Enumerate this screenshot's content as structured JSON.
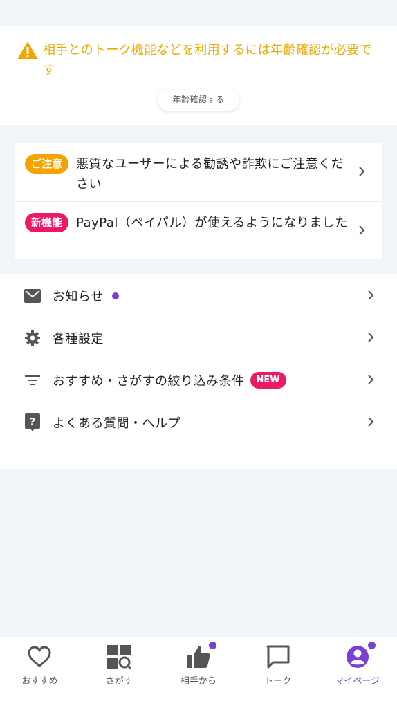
{
  "age_verification": {
    "message": "相手とのトーク機能などを利用するには年齢確認が必要です",
    "button_label": "年齢確認する",
    "accent_color": "#f0a800"
  },
  "notices": [
    {
      "badge": "ご注意",
      "badge_color": "#f5a300",
      "text": "悪質なユーザーによる勧誘や詐欺にご注意ください"
    },
    {
      "badge": "新機能",
      "badge_color": "#ec1a64",
      "text": "PayPal（ペイパル）が使えるようになりました"
    }
  ],
  "menu": [
    {
      "label": "お知らせ",
      "icon": "mail-icon",
      "has_dot": true
    },
    {
      "label": "各種設定",
      "icon": "gear-icon"
    },
    {
      "label": "おすすめ・さがすの絞り込み条件",
      "icon": "filter-icon",
      "badge": "NEW"
    },
    {
      "label": "よくある質問・ヘルプ",
      "icon": "help-icon"
    }
  ],
  "tabs": [
    {
      "label": "おすすめ",
      "icon": "heart-icon"
    },
    {
      "label": "さがす",
      "icon": "search-grid-icon"
    },
    {
      "label": "相手から",
      "icon": "thumbs-up-icon",
      "has_dot": true
    },
    {
      "label": "トーク",
      "icon": "chat-icon"
    },
    {
      "label": "マイページ",
      "icon": "profile-icon",
      "has_dot": true,
      "active": true
    }
  ],
  "colors": {
    "accent": "#7a3fd4",
    "new_badge": "#ec1a64"
  }
}
